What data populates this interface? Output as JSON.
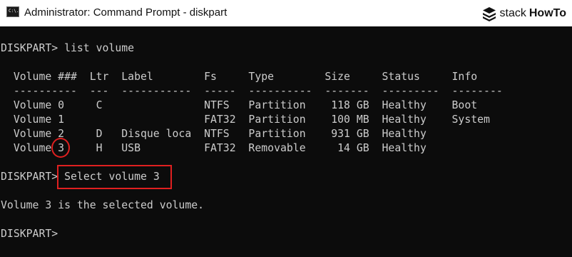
{
  "window": {
    "title": "Administrator: Command Prompt - diskpart",
    "icon": "console-app-icon",
    "icon_text": "C:\\."
  },
  "watermark": {
    "brand_a": "stack",
    "brand_b": "HowTo",
    "icon": "stackhowto-logo-icon"
  },
  "console": {
    "prompt_1": "DISKPART> list volume",
    "table_header": "  Volume ###  Ltr  Label        Fs     Type        Size     Status     Info",
    "table_rule": "  ----------  ---  -----------  -----  ----------  -------  ---------  --------",
    "rows": [
      "  Volume 0     C                NTFS   Partition    118 GB  Healthy    Boot",
      "  Volume 1                      FAT32  Partition    100 MB  Healthy    System",
      "  Volume 2     D   Disque loca  NTFS   Partition    931 GB  Healthy",
      "  Volume 3     H   USB          FAT32  Removable     14 GB  Healthy"
    ],
    "prompt_2_label": "DISKPART>",
    "prompt_2_command": " Select volume 3",
    "result": "Volume 3 is the selected volume.",
    "prompt_3": "DISKPART>"
  },
  "colors": {
    "console_bg": "#0c0c0c",
    "console_fg": "#cccccc",
    "highlight": "#e02020"
  }
}
